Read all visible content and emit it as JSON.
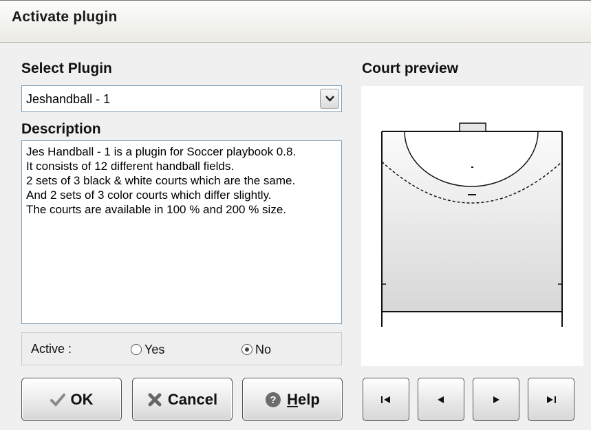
{
  "window": {
    "title": "Activate plugin"
  },
  "select_plugin": {
    "heading": "Select Plugin",
    "selected": "Jeshandball - 1"
  },
  "description": {
    "heading": "Description",
    "text": "Jes Handball - 1 is a plugin for Soccer playbook 0.8.\nIt consists of 12 different handball fields.\n2 sets of 3 black & white courts which are the same.\nAnd 2 sets of 3 color courts which differ slightly.\nThe courts are available in 100 % and 200 % size."
  },
  "active": {
    "label": "Active :",
    "options": [
      "Yes",
      "No"
    ],
    "selected": "No"
  },
  "buttons": {
    "ok": "OK",
    "cancel": "Cancel",
    "help_prefix": "",
    "help_underlined": "H",
    "help_rest": "elp"
  },
  "preview": {
    "heading": "Court preview"
  },
  "nav": {
    "icons": [
      "first-icon",
      "previous-icon",
      "next-icon",
      "last-icon"
    ]
  },
  "colors": {
    "window_bg": "#f0f0f0",
    "border": "#7f9db9"
  }
}
